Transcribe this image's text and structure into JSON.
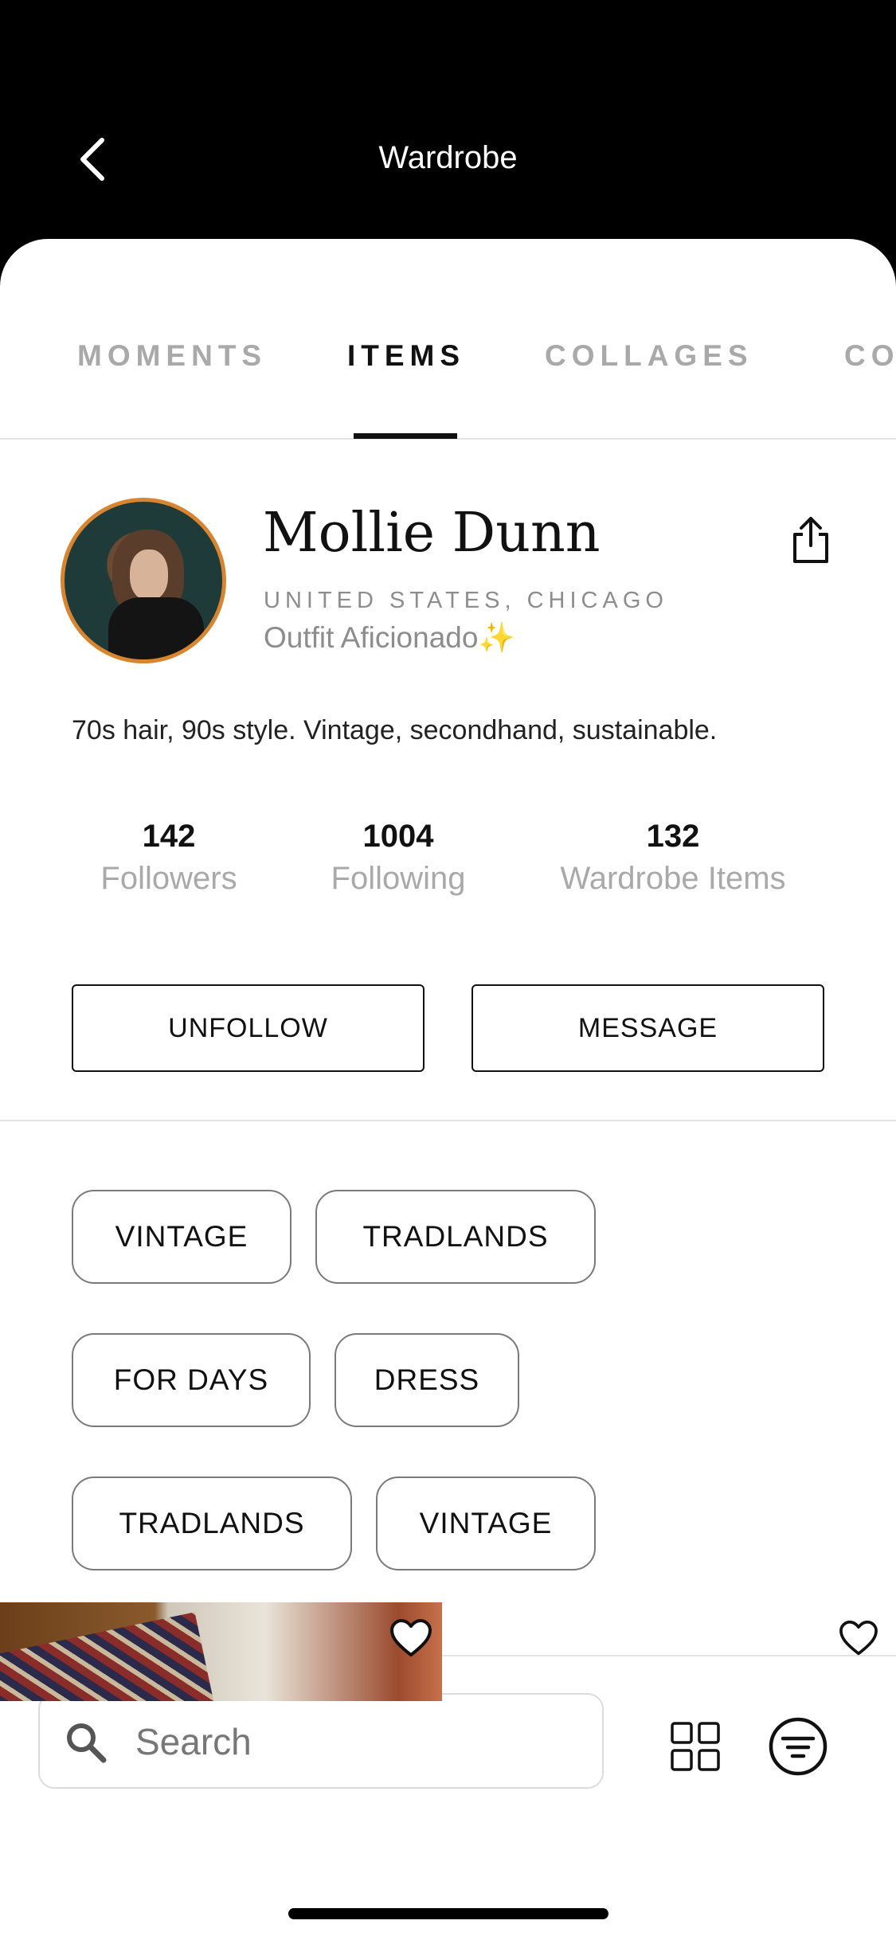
{
  "header": {
    "title": "Wardrobe",
    "back_icon": "chevron-left-icon"
  },
  "tabs": [
    {
      "label": "MOMENTS",
      "active": false
    },
    {
      "label": "ITEMS",
      "active": true
    },
    {
      "label": "COLLAGES",
      "active": false
    },
    {
      "label": "CO",
      "active": false
    }
  ],
  "profile": {
    "name": "Mollie Dunn",
    "location": "UNITED STATES, CHICAGO",
    "role": "Outfit Aficionado✨",
    "bio": "70s hair, 90s style. Vintage, secondhand, sustainable.",
    "avatar_border_color": "#d9842e",
    "share_icon": "share-icon"
  },
  "stats": [
    {
      "value": "142",
      "label": "Followers"
    },
    {
      "value": "1004",
      "label": "Following"
    },
    {
      "value": "132",
      "label": "Wardrobe Items"
    }
  ],
  "actions": {
    "unfollow": "UNFOLLOW",
    "message": "MESSAGE"
  },
  "tags": [
    "VINTAGE",
    "TRADLANDS",
    "FOR DAYS",
    "DRESS",
    "TRADLANDS",
    "VINTAGE"
  ],
  "search": {
    "placeholder": "Search",
    "value": ""
  },
  "toolbar": {
    "grid_icon": "grid-view-icon",
    "filter_icon": "filter-icon"
  },
  "items": [
    {
      "icon": "heart-icon"
    },
    {
      "icon": "heart-icon"
    }
  ]
}
